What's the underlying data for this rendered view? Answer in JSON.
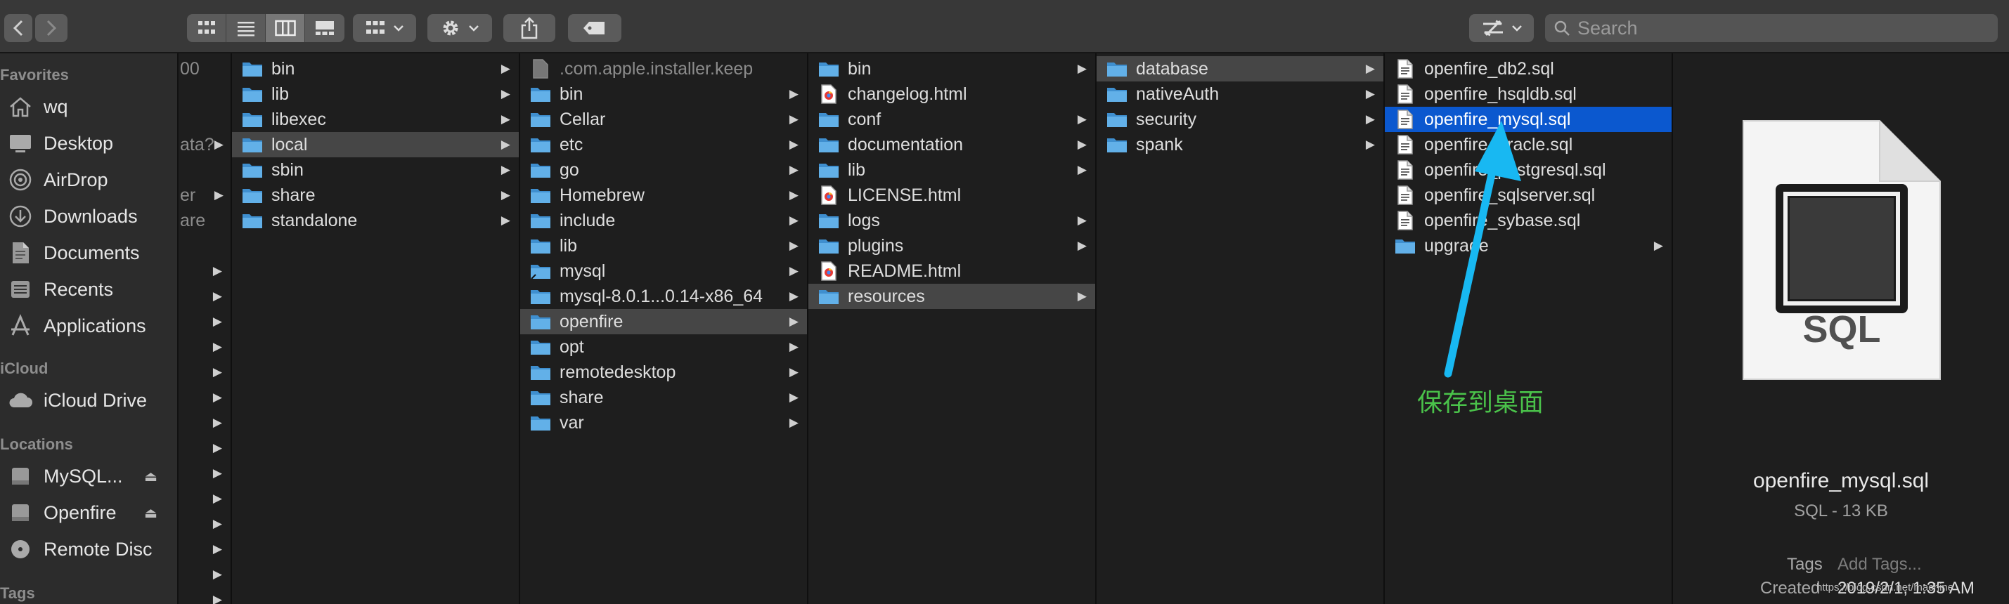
{
  "toolbar": {
    "search_placeholder": "Search"
  },
  "sidebar": {
    "favorites_header": "Favorites",
    "favorites": [
      {
        "label": "wq",
        "icon": "home-icon"
      },
      {
        "label": "Desktop",
        "icon": "desktop-icon"
      },
      {
        "label": "AirDrop",
        "icon": "airdrop-icon"
      },
      {
        "label": "Downloads",
        "icon": "downloads-icon"
      },
      {
        "label": "Documents",
        "icon": "documents-icon"
      },
      {
        "label": "Recents",
        "icon": "recents-icon"
      },
      {
        "label": "Applications",
        "icon": "applications-icon"
      }
    ],
    "icloud_header": "iCloud",
    "icloud_drive": "iCloud Drive",
    "locations_header": "Locations",
    "locations": [
      {
        "label": "MySQL..."
      },
      {
        "label": "Openfire"
      },
      {
        "label": "Remote Disc"
      }
    ],
    "tags_header": "Tags"
  },
  "col0": {
    "items": [
      "00",
      "ata?",
      "er",
      "are"
    ]
  },
  "col1": {
    "items": [
      "bin",
      "lib",
      "libexec",
      "local",
      "sbin",
      "share",
      "standalone"
    ]
  },
  "col2": {
    "items": [
      ".com.apple.installer.keep",
      "bin",
      "Cellar",
      "etc",
      "go",
      "Homebrew",
      "include",
      "lib",
      "mysql",
      "mysql-8.0.1...0.14-x86_64",
      "openfire",
      "opt",
      "remotedesktop",
      "share",
      "var"
    ]
  },
  "col3": {
    "items": [
      "bin",
      "changelog.html",
      "conf",
      "documentation",
      "lib",
      "LICENSE.html",
      "logs",
      "plugins",
      "README.html",
      "resources"
    ]
  },
  "col4": {
    "items": [
      "database",
      "nativeAuth",
      "security",
      "spank"
    ]
  },
  "col5": {
    "items": [
      "openfire_db2.sql",
      "openfire_hsqldb.sql",
      "openfire_mysql.sql",
      "openfire_oracle.sql",
      "openfire_postgresql.sql",
      "openfire_sqlserver.sql",
      "openfire_sybase.sql",
      "upgrade"
    ]
  },
  "preview": {
    "icon_label": "SQL",
    "file_name": "openfire_mysql.sql",
    "file_info": "SQL - 13 KB",
    "tags_label": "Tags",
    "tags_placeholder": "Add Tags...",
    "created_label": "Created",
    "created_value": "2019/2/1, 1:35 AM"
  },
  "annotation": {
    "text": "保存到桌面"
  },
  "watermark": "https://blog.csdn.net/machine"
}
